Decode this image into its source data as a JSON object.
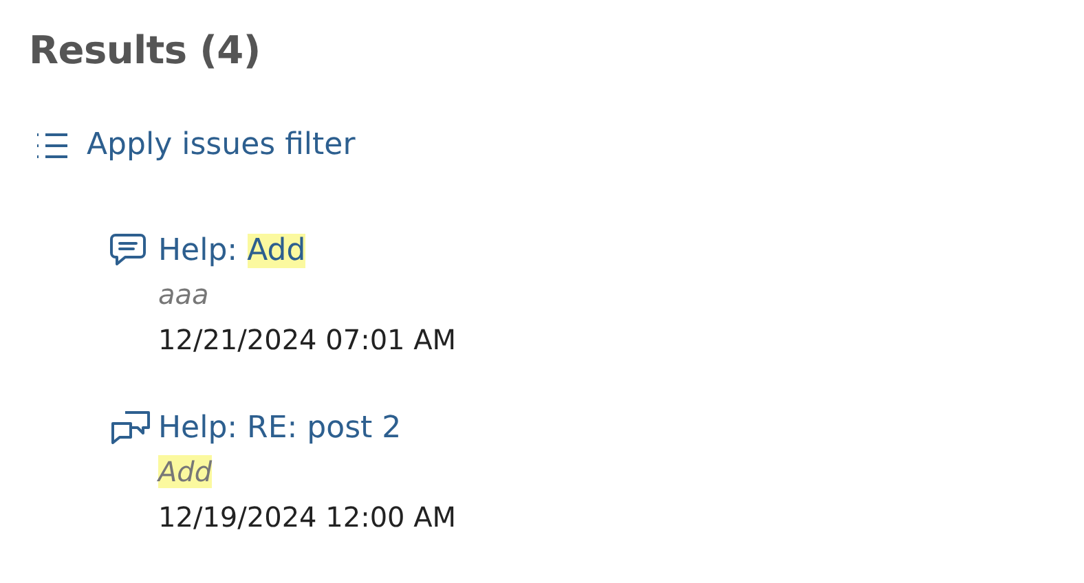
{
  "heading": "Results (4)",
  "filter_link": "Apply issues filter",
  "results": [
    {
      "kind": "comment",
      "title": [
        {
          "text": "Help: ",
          "highlighted": false
        },
        {
          "text": "Add",
          "highlighted": true
        }
      ],
      "snippet": [
        {
          "text": "aaa",
          "highlighted": false
        }
      ],
      "date": "12/21/2024 07:01 AM"
    },
    {
      "kind": "discussion",
      "title": [
        {
          "text": "Help: RE: post 2",
          "highlighted": false
        }
      ],
      "snippet": [
        {
          "text": "Add",
          "highlighted": true
        }
      ],
      "date": "12/19/2024 12:00 AM"
    }
  ]
}
